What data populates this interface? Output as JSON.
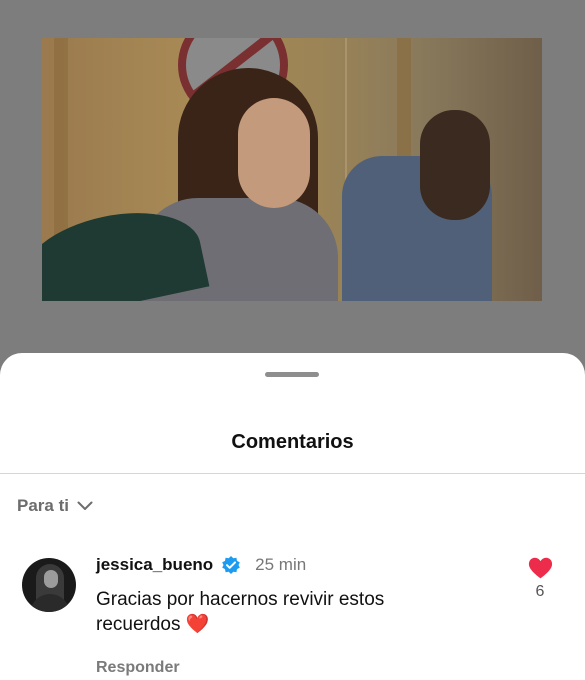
{
  "sheet": {
    "title": "Comentarios",
    "filter_label": "Para ti"
  },
  "comment": {
    "username": "jessica_bueno",
    "verified": true,
    "time": "25 min",
    "text": "Gracias por hacernos revivir estos recuerdos",
    "emoji": "❤️",
    "reply_label": "Responder",
    "likes": "6",
    "liked": true
  },
  "colors": {
    "like_red": "#ed2b4a",
    "verified_blue": "#1d9bf0"
  },
  "icons": {
    "filter": "chevron-down-icon",
    "verified": "verified-badge-icon",
    "like": "heart-icon"
  }
}
